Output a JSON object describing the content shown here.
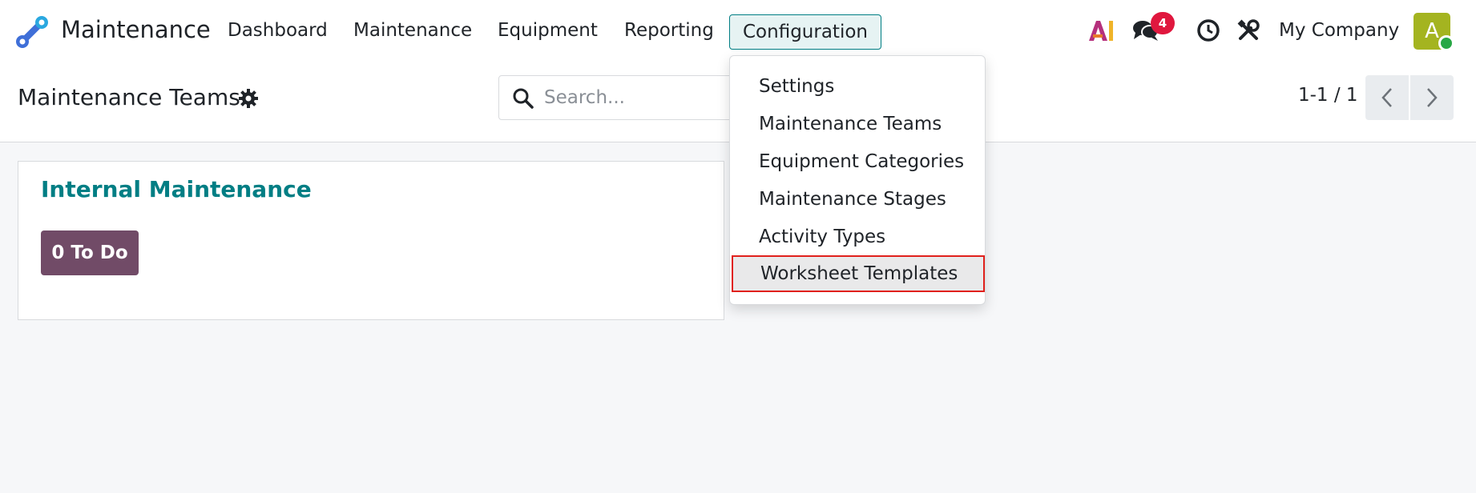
{
  "navbar": {
    "app_name": "Maintenance",
    "menu": [
      "Dashboard",
      "Maintenance",
      "Equipment",
      "Reporting",
      "Configuration"
    ],
    "active_menu": "Configuration",
    "discuss_badge": "4",
    "company": "My Company",
    "avatar_letter": "A",
    "ai_label": "AI"
  },
  "control_panel": {
    "title": "Maintenance Teams",
    "search_placeholder": "Search...",
    "pager": "1-1 / 1"
  },
  "team_card": {
    "name": "Internal Maintenance",
    "todo_label": "0 To Do"
  },
  "dropdown": {
    "items": [
      "Settings",
      "Maintenance Teams",
      "Equipment Categories",
      "Maintenance Stages",
      "Activity Types",
      "Worksheet Templates"
    ],
    "highlighted": "Worksheet Templates"
  },
  "colors": {
    "accent": "#017e84",
    "todo_bg": "#714b67",
    "badge": "#e0173e",
    "highlight_border": "#e0211c"
  }
}
